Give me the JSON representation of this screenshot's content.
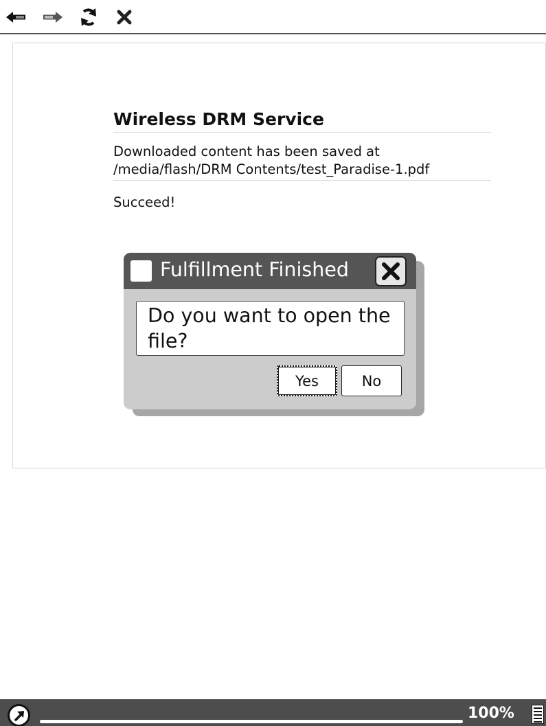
{
  "toolbar": {
    "back": {
      "icon": "back-arrow-icon"
    },
    "forward": {
      "icon": "forward-arrow-icon"
    },
    "reload": {
      "icon": "reload-icon"
    },
    "stop": {
      "icon": "stop-icon"
    }
  },
  "page": {
    "title": "Wireless DRM Service",
    "message_line1": "Downloaded content has been saved at",
    "message_line2": "/media/flash/DRM Contents/test_Paradise-1.pdf",
    "status": "Succeed!"
  },
  "dialog": {
    "title": "Fulfillment Finished",
    "message": "Do you want to open the file?",
    "yes_label": "Yes",
    "no_label": "No",
    "close_icon": "close-icon",
    "checkbox_checked": false
  },
  "statusbar": {
    "menu_icon": "arrow-up-right-icon",
    "zoom": "100%",
    "battery_icon": "battery-icon"
  },
  "colors": {
    "titlebar": "#555555",
    "dialog_body": "#cccccc",
    "statusbar": "#4d4d4d"
  }
}
